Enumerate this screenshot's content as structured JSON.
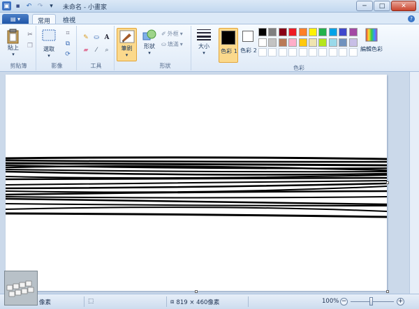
{
  "window": {
    "title": "未命名 - 小畫家"
  },
  "tabs": {
    "home": "常用",
    "view": "檢視"
  },
  "ribbon": {
    "clipboard": {
      "paste": "貼上",
      "group": "剪貼簿"
    },
    "image": {
      "select": "選取",
      "group": "影像"
    },
    "tools": {
      "group": "工具"
    },
    "brushes": {
      "label": "筆刷"
    },
    "shapes": {
      "shapes": "形狀",
      "outline": "外框",
      "fill": "填滿",
      "group": "形狀"
    },
    "size": {
      "label": "大小"
    },
    "colors": {
      "color1": "色彩 1",
      "color2": "色彩 2",
      "edit": "編輯色彩",
      "group": "色彩",
      "color1_value": "#000000",
      "color2_value": "#ffffff",
      "palette_row1": [
        "#000000",
        "#7f7f7f",
        "#880015",
        "#ed1c24",
        "#ff7f27",
        "#fff200",
        "#22b14c",
        "#00a2e8",
        "#3f48cc",
        "#a349a4"
      ],
      "palette_row2": [
        "#ffffff",
        "#c3c3c3",
        "#b97a57",
        "#ffaec9",
        "#ffc90e",
        "#efe4b0",
        "#b5e61d",
        "#99d9ea",
        "#7092be",
        "#c8bfe7"
      ]
    }
  },
  "status": {
    "pixel_unit": "像素",
    "dimensions": "819 × 460像素",
    "zoom": "100%"
  }
}
